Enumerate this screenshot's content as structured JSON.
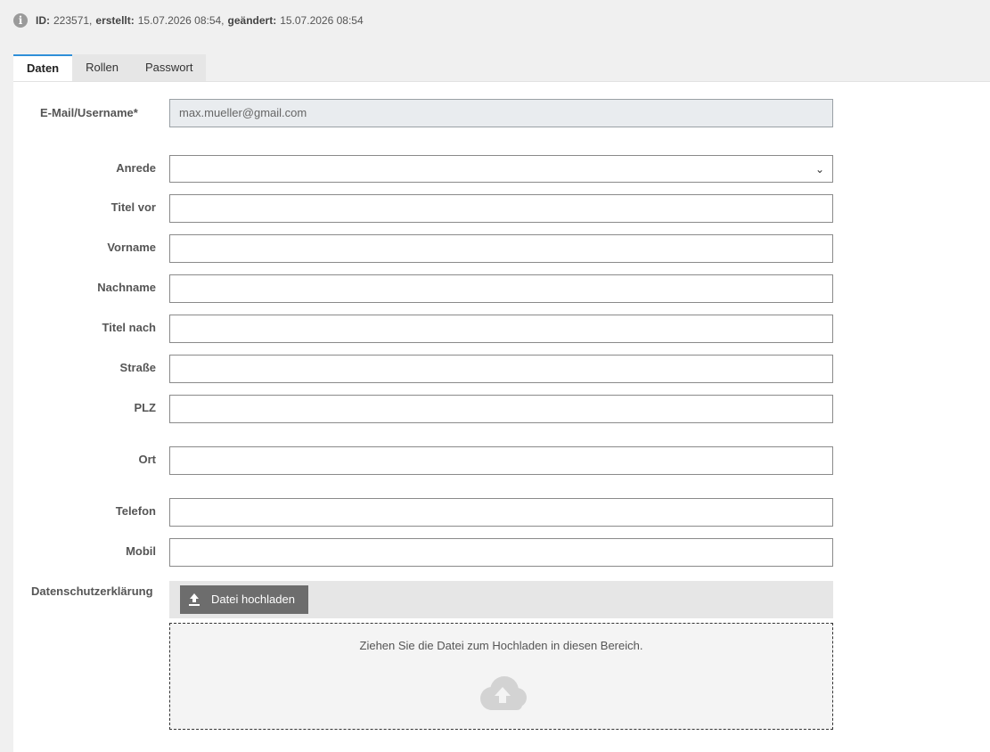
{
  "meta": {
    "id_label": "ID:",
    "id_value": "223571,",
    "created_label": "erstellt:",
    "created_value": "15.07.2026 08:54,",
    "changed_label": "geändert:",
    "changed_value": "15.07.2026 08:54"
  },
  "tabs": [
    {
      "label": "Daten",
      "active": true
    },
    {
      "label": "Rollen",
      "active": false
    },
    {
      "label": "Passwort",
      "active": false
    }
  ],
  "form": {
    "email_label": "E-Mail/Username*",
    "email_value": "max.mueller@gmail.com",
    "anrede_label": "Anrede",
    "anrede_value": "",
    "titel_vor_label": "Titel vor",
    "vorname_label": "Vorname",
    "nachname_label": "Nachname",
    "titel_nach_label": "Titel nach",
    "strasse_label": "Straße",
    "plz_label": "PLZ",
    "ort_label": "Ort",
    "telefon_label": "Telefon",
    "mobil_label": "Mobil",
    "datenschutz_label": "Datenschutzerklärung"
  },
  "upload": {
    "button_label": "Datei hochladen",
    "dropzone_text": "Ziehen Sie die Datei zum Hochladen in diesen Bereich."
  },
  "icons": {
    "info": "info-circle-icon",
    "upload": "upload-icon",
    "cloud": "cloud-upload-icon",
    "chevron": "chevron-down-icon"
  },
  "colors": {
    "active_tab_border": "#2f8fd8",
    "upload_button": "#6d6d6d",
    "readonly_field": "#e9ecef"
  }
}
